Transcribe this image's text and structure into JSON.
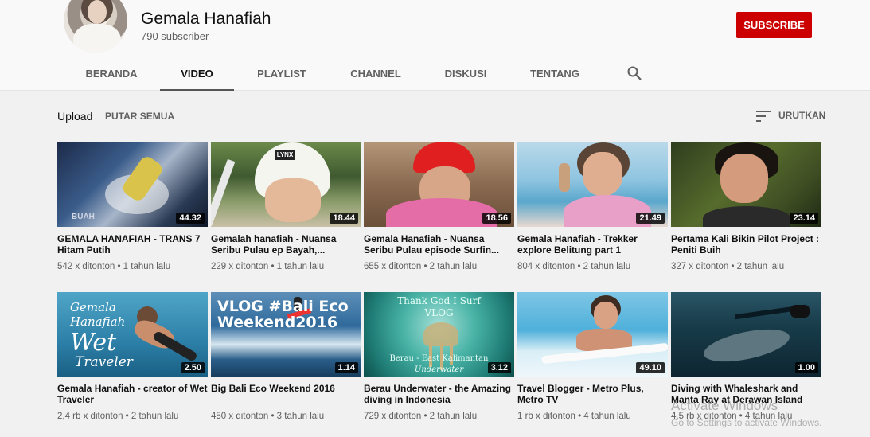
{
  "channel": {
    "name": "Gemala Hanafiah",
    "subscribers": "790 subscriber",
    "subscribe_label": "SUBSCRIBE"
  },
  "tabs": [
    {
      "label": "BERANDA"
    },
    {
      "label": "VIDEO"
    },
    {
      "label": "PLAYLIST"
    },
    {
      "label": "CHANNEL"
    },
    {
      "label": "DISKUSI"
    },
    {
      "label": "TENTANG"
    }
  ],
  "toolbar": {
    "upload_label": "Upload",
    "play_all_label": "PUTAR SEMUA",
    "sort_label": "URUTKAN"
  },
  "videos": [
    {
      "title": "GEMALA HANAFIAH - TRANS 7 Hitam Putih",
      "duration": "44.32",
      "meta": "542 x ditonton • 1 tahun lalu"
    },
    {
      "title": "Gemalah hanafiah - Nuansa Seribu Pulau ep Bayah,...",
      "duration": "18.44",
      "meta": "229 x ditonton • 1 tahun lalu"
    },
    {
      "title": "Gemala Hanafiah - Nuansa Seribu Pulau episode Surfin...",
      "duration": "18.56",
      "meta": "655 x ditonton • 2 tahun lalu"
    },
    {
      "title": "Gemala Hanafiah - Trekker explore Belitung part 1",
      "duration": "21.49",
      "meta": "804 x ditonton • 2 tahun lalu"
    },
    {
      "title": "Pertama Kali Bikin Pilot Project : Peniti Buih",
      "duration": "23.14",
      "meta": "327 x ditonton • 2 tahun lalu"
    },
    {
      "title": "Gemala Hanafiah - creator of Wet Traveler",
      "duration": "2.50",
      "meta": "2,4 rb x ditonton • 2 tahun lalu"
    },
    {
      "title": "Big Bali Eco Weekend 2016",
      "duration": "1.14",
      "meta": "450 x ditonton • 3 tahun lalu"
    },
    {
      "title": "Berau Underwater - the Amazing diving in Indonesia",
      "duration": "3.12",
      "meta": "729 x ditonton • 2 tahun lalu"
    },
    {
      "title": "Travel Blogger - Metro Plus, Metro TV",
      "duration": "49.10",
      "meta": "1 rb x ditonton • 4 tahun lalu"
    },
    {
      "title": "Diving with Whaleshark and Manta Ray at Derawan Island",
      "duration": "1.00",
      "meta": "4,5 rb x ditonton • 4 tahun lalu"
    }
  ],
  "thumb_text": {
    "t6_line1": "Gemala",
    "t6_line2": "Hanafiah",
    "t6_line3": "Wet",
    "t6_line4": "Traveler",
    "t7_lines": "VLOG #Bali Eco Weekend2016",
    "t8_top1": "Thank God I Surf",
    "t8_top2": "VLOG",
    "t8_bottom1": "Berau - East Kalimantan",
    "t8_bottom2": "Underwater",
    "t2_helmet": "LYNX"
  },
  "watermark": {
    "line1": "Activate Windows",
    "line2": "Go to Settings to activate Windows."
  }
}
